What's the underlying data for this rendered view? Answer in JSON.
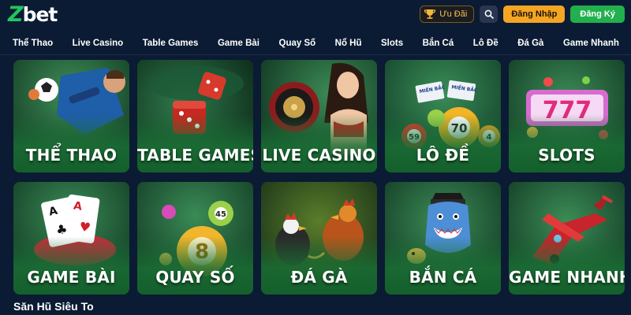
{
  "header": {
    "logo_text": "Zbet",
    "promo_label": "Ưu Đãi",
    "login_label": "Đăng Nhập",
    "register_label": "Đăng Ký",
    "brand_green": "#22b04e",
    "brand_orange": "#f5a524"
  },
  "nav": {
    "items": [
      "Thể Thao",
      "Live Casino",
      "Table Games",
      "Game Bài",
      "Quay Số",
      "Nổ Hũ",
      "Slots",
      "Bắn Cá",
      "Lô Đề",
      "Đá Gà",
      "Game Nhanh"
    ]
  },
  "tiles": [
    {
      "label": "THỂ THAO",
      "icon": "soccer-icon"
    },
    {
      "label": "TABLE GAMES",
      "icon": "dice-icon"
    },
    {
      "label": "LIVE CASINO",
      "icon": "roulette-icon"
    },
    {
      "label": "LÔ ĐỀ",
      "icon": "lottery-balls-icon"
    },
    {
      "label": "SLOTS",
      "icon": "slot-777-icon"
    },
    {
      "label": "GAME BÀI",
      "icon": "playing-cards-icon"
    },
    {
      "label": "QUAY SỐ",
      "icon": "number-ball-icon"
    },
    {
      "label": "ĐÁ GÀ",
      "icon": "rooster-icon"
    },
    {
      "label": "BẮN CÁ",
      "icon": "shark-icon"
    },
    {
      "label": "GAME NHANH",
      "icon": "plane-icon"
    }
  ],
  "lottery_balls": [
    "59",
    "70",
    "4"
  ],
  "lottery_tickets": [
    "MIỀN BẮC",
    "MIỀN BẮC"
  ],
  "slot_digits": "777",
  "quay_so_balls": [
    "8",
    "45"
  ],
  "section_title": "Săn Hũ Siêu To"
}
